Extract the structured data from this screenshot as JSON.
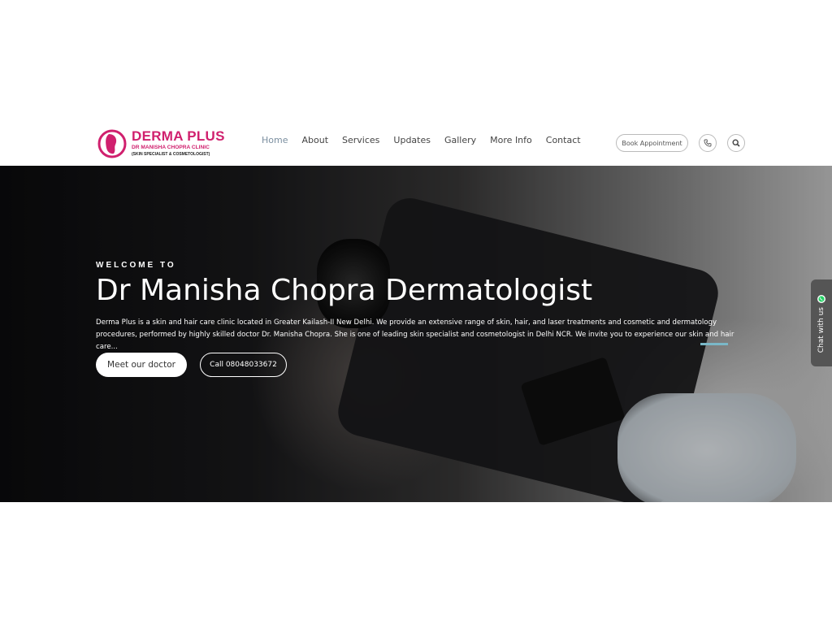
{
  "brand": {
    "title": "DERMA PLUS",
    "subtitle": "DR MANISHA CHOPRA CLINIC",
    "tagline": "(SKIN SPECIALIST & COSMETOLOGIST)",
    "color": "#d0206e"
  },
  "nav": {
    "items": [
      {
        "label": "Home",
        "active": true
      },
      {
        "label": "About"
      },
      {
        "label": "Services"
      },
      {
        "label": "Updates"
      },
      {
        "label": "Gallery"
      },
      {
        "label": "More Info"
      },
      {
        "label": "Contact"
      }
    ]
  },
  "header_actions": {
    "book_label": "Book Appointment",
    "phone_icon": "phone-icon",
    "search_icon": "search-icon"
  },
  "hero": {
    "welcome": "WELCOME TO",
    "title": "Dr Manisha Chopra Dermatologist",
    "description": "Derma Plus is a skin and hair care clinic located in Greater Kailash-II New Delhi.  We provide an extensive range of skin, hair, and laser treatments and cosmetic and dermatology procedures, performed by highly skilled doctor Dr. Manisha Chopra. She is one of leading skin specialist and cosmetologist in Delhi NCR. We invite you to experience our skin and hair care...",
    "primary_button": "Meet our doctor",
    "secondary_button": "Call 08048033672"
  },
  "chat": {
    "label": "Chat with us",
    "icon": "whatsapp-icon"
  }
}
